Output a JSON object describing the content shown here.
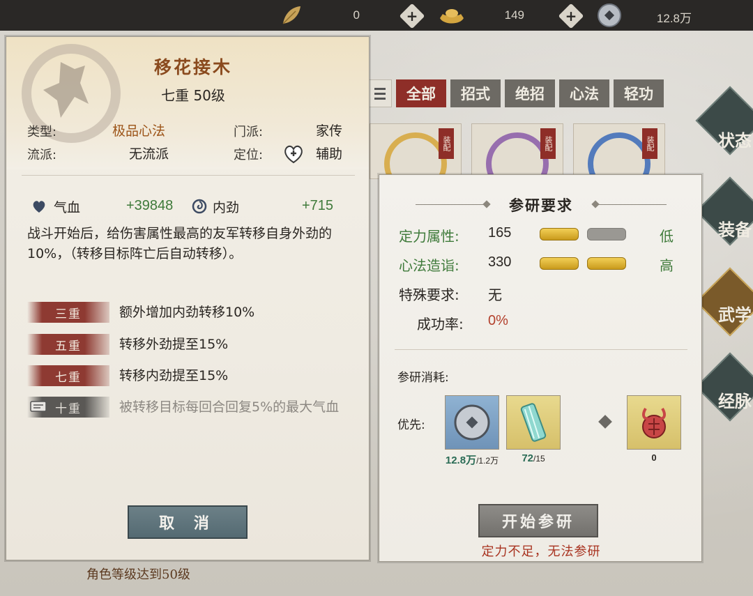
{
  "topbar": {
    "resources": [
      {
        "icon": "leaf-icon",
        "value": "0"
      },
      {
        "icon": "gold-ingot-icon",
        "value": "149"
      },
      {
        "icon": "coin-icon",
        "value": "12.8万"
      }
    ]
  },
  "filter_tabs": [
    "全部",
    "招式",
    "绝招",
    "心法",
    "轻功"
  ],
  "card_tag": "装配",
  "side_nav": [
    "状态",
    "装备",
    "武学",
    "经脉"
  ],
  "bottom_hint": "角色等级达到50级",
  "skill": {
    "name": "移花接木",
    "level": "七重 50级",
    "type_label": "类型:",
    "type_value": "极品心法",
    "sect_label": "门派:",
    "sect_value": "家传",
    "school_label": "流派:",
    "school_value": "无流派",
    "role_label": "定位:",
    "role_value": "辅助",
    "stats": [
      {
        "icon": "heart-icon",
        "label": "气血",
        "value": "+39848"
      },
      {
        "icon": "swirl-icon",
        "label": "内劲",
        "value": "+715"
      }
    ],
    "description": "战斗开始后，给伤害属性最高的友军转移自身外劲的10%，（转移目标阵亡后自动转移）。",
    "tiers": [
      {
        "badge": "三重",
        "text": "额外增加内劲转移10%",
        "locked": false
      },
      {
        "badge": "五重",
        "text": "转移外劲提至15%",
        "locked": false
      },
      {
        "badge": "七重",
        "text": "转移内劲提至15%",
        "locked": false
      },
      {
        "badge": "十重",
        "text": "被转移目标每回合回复5%的最大气血",
        "locked": true
      }
    ],
    "cancel_label": "取 消"
  },
  "research": {
    "title": "参研要求",
    "requirements": [
      {
        "label": "定力属性:",
        "value": "165",
        "grade": "低",
        "pills": [
          "gold",
          "gray"
        ]
      },
      {
        "label": "心法造诣:",
        "value": "330",
        "grade": "高",
        "pills": [
          "gold",
          "gold"
        ]
      }
    ],
    "special_label": "特殊要求:",
    "special_value": "无",
    "success_label": "成功率:",
    "success_value": "0%",
    "cost_label": "参研消耗:",
    "priority_label": "优先:",
    "items": [
      {
        "icon": "copper-coin-icon",
        "count_have": "12.8万",
        "count_need": "/1.2万"
      },
      {
        "icon": "jade-tube-icon",
        "count_have": "72",
        "count_need": "/15"
      },
      {
        "icon": "red-knot-icon",
        "count_have": "0",
        "count_need": ""
      }
    ],
    "start_label": "开始参研",
    "warning": "定力不足，无法参研"
  },
  "colors": {
    "quality": "#9c5418",
    "positive": "#3f7a3a",
    "warning": "#a8321f",
    "tier_badge": "#8e3a32"
  }
}
